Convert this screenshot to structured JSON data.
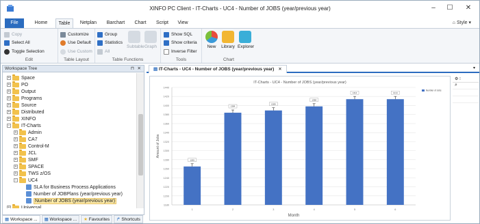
{
  "window": {
    "title": "XINFO PC Client - IT-Charts - UC4 - Number of JOBS (year/previous year)",
    "controls": {
      "minimize": "–",
      "maximize": "☐",
      "close": "✕"
    }
  },
  "menubar": {
    "tabs": [
      "File",
      "Home",
      "Table",
      "Netplan",
      "Barchart",
      "Chart",
      "Script",
      "View"
    ],
    "active_tab": "Table",
    "style_label": "Style"
  },
  "ribbon": {
    "groups": {
      "edit": {
        "label": "Edit",
        "copy": "Copy",
        "select_all": "Select All",
        "toggle_selection": "Toggle Selection"
      },
      "table_layout": {
        "label": "Table Layout",
        "customize": "Customize",
        "use_default": "Use Default",
        "use_custom": "Use Custom"
      },
      "table_functions": {
        "label": "Table Functions",
        "group": "Group",
        "statistics": "Statistics",
        "all": "All",
        "subtable": "Subtable",
        "graph": "Graph"
      },
      "tools": {
        "label": "Tools",
        "show_sql": "Show SQL",
        "show_criteria": "Show criteria",
        "inverse_filter": "Inverse Filter"
      },
      "chart": {
        "label": "Chart",
        "new": "New",
        "library": "Library",
        "explorer": "Explorer"
      }
    }
  },
  "workspace": {
    "title": "Workspace Tree",
    "pin": "⊓",
    "close": "✕",
    "tree": [
      {
        "label": "Space",
        "type": "folder",
        "level": 0,
        "expander": "+"
      },
      {
        "label": "PO",
        "type": "folder",
        "level": 0,
        "expander": "+"
      },
      {
        "label": "Output",
        "type": "folder",
        "level": 0,
        "expander": "+"
      },
      {
        "label": "Programs",
        "type": "folder",
        "level": 0,
        "expander": "+"
      },
      {
        "label": "Source",
        "type": "folder",
        "level": 0,
        "expander": "+"
      },
      {
        "label": "Distributed",
        "type": "folder",
        "level": 0,
        "expander": "+"
      },
      {
        "label": "XINFO",
        "type": "folder",
        "level": 0,
        "expander": "+"
      },
      {
        "label": "IT-Charts",
        "type": "folder",
        "level": 0,
        "expander": "−"
      },
      {
        "label": "Admin",
        "type": "folder",
        "level": 1,
        "expander": "+"
      },
      {
        "label": "CA7",
        "type": "folder",
        "level": 1,
        "expander": "+"
      },
      {
        "label": "Control-M",
        "type": "folder",
        "level": 1,
        "expander": "+"
      },
      {
        "label": "JCL",
        "type": "folder",
        "level": 1,
        "expander": "+"
      },
      {
        "label": "SMF",
        "type": "folder",
        "level": 1,
        "expander": "+"
      },
      {
        "label": "SPACE",
        "type": "folder",
        "level": 1,
        "expander": "+"
      },
      {
        "label": "TWS z/OS",
        "type": "folder",
        "level": 1,
        "expander": "+"
      },
      {
        "label": "UC4",
        "type": "folder",
        "level": 1,
        "expander": "−"
      },
      {
        "label": "SLA for Business Process Applications",
        "type": "doc",
        "level": 2
      },
      {
        "label": "Number of JOBPlans (year/previous year)",
        "type": "doc",
        "level": 2
      },
      {
        "label": "Number of JOBS (year/previous year)",
        "type": "doc",
        "level": 2,
        "selected": true
      },
      {
        "label": "Universal",
        "type": "folder",
        "level": 0,
        "expander": "+"
      }
    ],
    "bottom_tabs": [
      "Workspace ...",
      "Workspace ...",
      "Favourites",
      "Shortcuts"
    ]
  },
  "document_tab": {
    "label": "IT-Charts - UC4 - Number of JOBS (year/previous year)",
    "close": "✕"
  },
  "chart_data": {
    "type": "bar",
    "title": "IT-Charts - UC4 - Number of JOBS (year/previous year)",
    "xlabel": "Month",
    "ylabel": "Amount of Jobs",
    "categories": [
      "1",
      "2",
      "3",
      "4",
      "5",
      "6"
    ],
    "series": [
      {
        "name": "Number of Jobs",
        "values": [
          1265,
          1384,
          1389,
          1398,
          1414,
          1414
        ],
        "color": "#4472c4"
      }
    ],
    "ylim": [
      1180,
      1440
    ],
    "yticks": [
      1180,
      1200,
      1220,
      1240,
      1260,
      1280,
      1300,
      1320,
      1340,
      1360,
      1380,
      1400,
      1420,
      1440
    ],
    "grid": true,
    "legend": "top-right"
  },
  "colors": {
    "accent": "#2b6cbf",
    "bar": "#4472c4",
    "folder": "#f2c24d"
  }
}
